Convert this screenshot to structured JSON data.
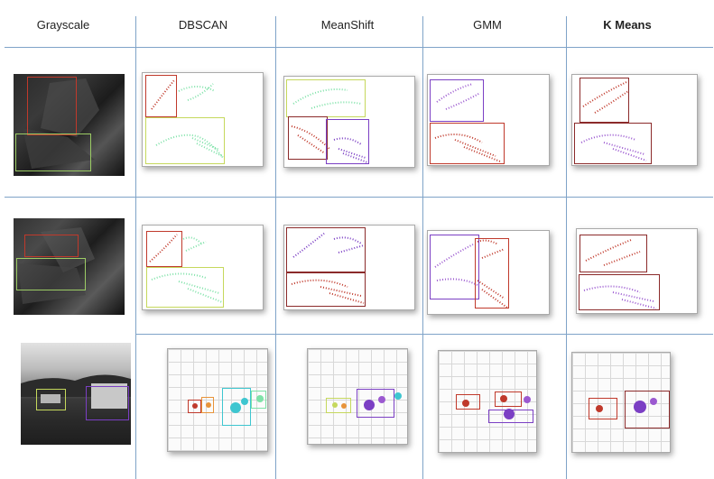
{
  "headers": [
    "Grayscale",
    "DBSCAN",
    "MeanShift",
    "GMM",
    "K Means"
  ],
  "colors": {
    "grid_line": "#7fa3c8",
    "red": "#c0392b",
    "dark_red": "#8b2a2a",
    "green": "#9ccc65",
    "mint": "#7ee2a8",
    "purple": "#7b3fc4",
    "violet": "#9b59d0",
    "orange": "#e8943a",
    "cyan": "#3ec6d0",
    "yellow_green": "#c5d85c"
  }
}
